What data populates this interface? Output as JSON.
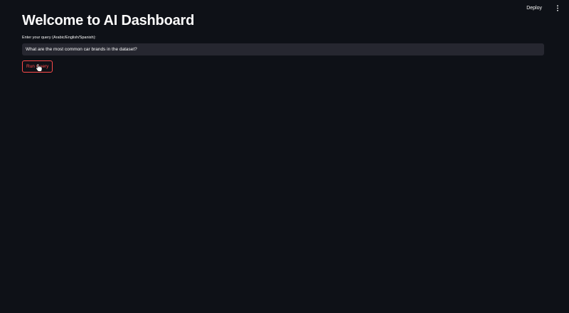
{
  "toolbar": {
    "deploy_label": "Deploy",
    "menu_icon": "kebab-menu-icon"
  },
  "main": {
    "title": "Welcome to AI Dashboard",
    "query_label": "Enter your query (Arabic/English/Spanish):",
    "query_value": "What are the most common car brands in the dataset?",
    "run_button_label": "Run Query"
  },
  "colors": {
    "background": "#0e1117",
    "input_background": "#262730",
    "text": "#fafafa",
    "accent": "#ff4b4b"
  },
  "icons": {
    "cursor": "hand-pointer-icon"
  }
}
